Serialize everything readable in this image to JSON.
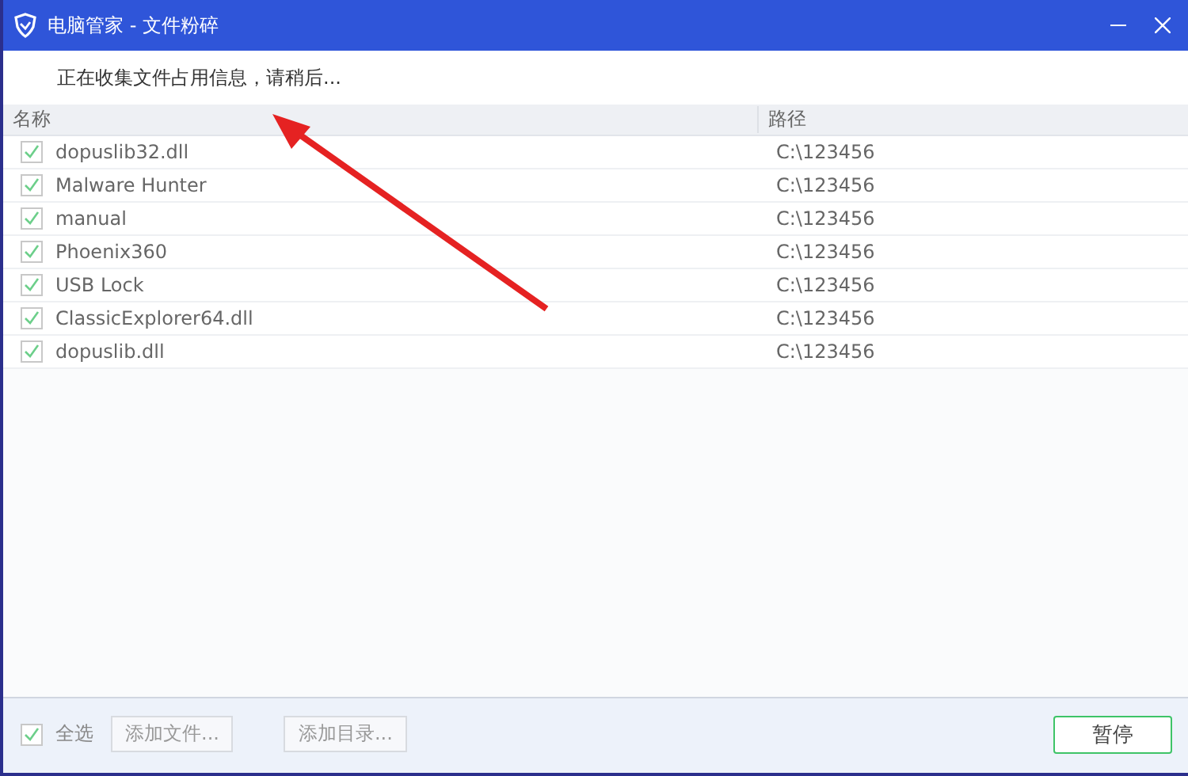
{
  "window": {
    "title": "电脑管家 - 文件粉碎"
  },
  "status": "正在收集文件占用信息，请稍后...",
  "table": {
    "columns": [
      "名称",
      "路径"
    ],
    "rows": [
      {
        "name": "dopuslib32.dll",
        "path": "C:\\123456",
        "checked": true
      },
      {
        "name": "Malware Hunter",
        "path": "C:\\123456",
        "checked": true
      },
      {
        "name": "manual",
        "path": "C:\\123456",
        "checked": true
      },
      {
        "name": "Phoenix360",
        "path": "C:\\123456",
        "checked": true
      },
      {
        "name": "USB Lock",
        "path": "C:\\123456",
        "checked": true
      },
      {
        "name": "ClassicExplorer64.dll",
        "path": "C:\\123456",
        "checked": true
      },
      {
        "name": "dopuslib.dll",
        "path": "C:\\123456",
        "checked": true
      }
    ]
  },
  "footer": {
    "select_all": {
      "label": "全选",
      "checked": true
    },
    "buttons": [
      "添加文件...",
      "添加目录..."
    ],
    "primary": "暂停"
  }
}
